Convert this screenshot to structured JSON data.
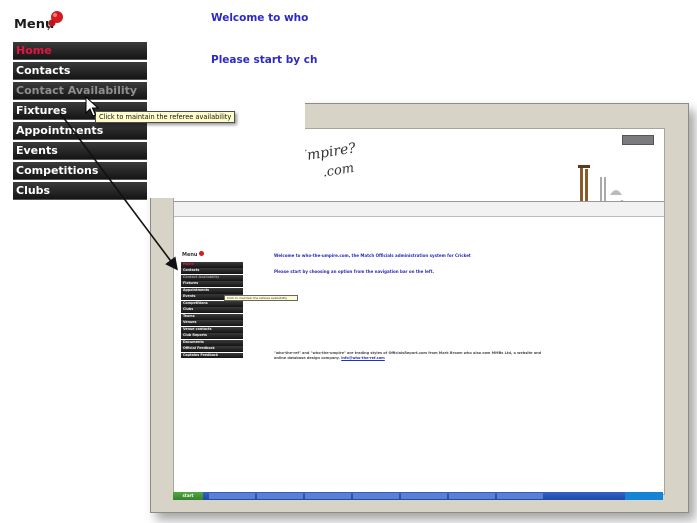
{
  "menu": {
    "title": "Menu",
    "items": [
      {
        "label": "Home",
        "state": "home"
      },
      {
        "label": "Contacts",
        "state": "normal"
      },
      {
        "label": "Contact Availability",
        "state": "selected"
      },
      {
        "label": "Fixtures",
        "state": "normal"
      },
      {
        "label": "Appointments",
        "state": "normal"
      },
      {
        "label": "Events",
        "state": "normal"
      },
      {
        "label": "Competitions",
        "state": "normal"
      },
      {
        "label": "Clubs",
        "state": "normal"
      }
    ]
  },
  "tooltip": "Click to maintain the referee availability",
  "welcome_text": "Welcome to who",
  "please_text": "Please start by ch",
  "screenshot": {
    "banner_title": "the Umpire?",
    "banner_suffix": ".com",
    "welcome_text": "Welcome to who-the-umpire.com, the Match Officials administration system for Cricket",
    "please_text": "Please start by choosing an option from the navigation bar on the left.",
    "footer_text": "\"who-the-ref\" and \"who-the-umpire\" are trading styles of OfficialsReport.com from Mark Brown who also own MMBs Ltd, a website and online database design company.",
    "footer_link": "info@who-the-ref.com",
    "menu_title": "Menu",
    "menu_items": [
      "Home",
      "Contacts",
      "Contact Availability",
      "Fixtures",
      "Appointments",
      "Events",
      "Competitions",
      "Clubs",
      "Teams",
      "Venues",
      "Venue contacts",
      "Club Reports",
      "Documents",
      "Official Feedback",
      "Captains Feedback"
    ],
    "start_label": "start"
  },
  "colors": {
    "menu_home": "#e4153f",
    "menu_selected": "#8e8e8e",
    "heading_blue": "#2d29c4",
    "pin_red": "#d01c22"
  }
}
